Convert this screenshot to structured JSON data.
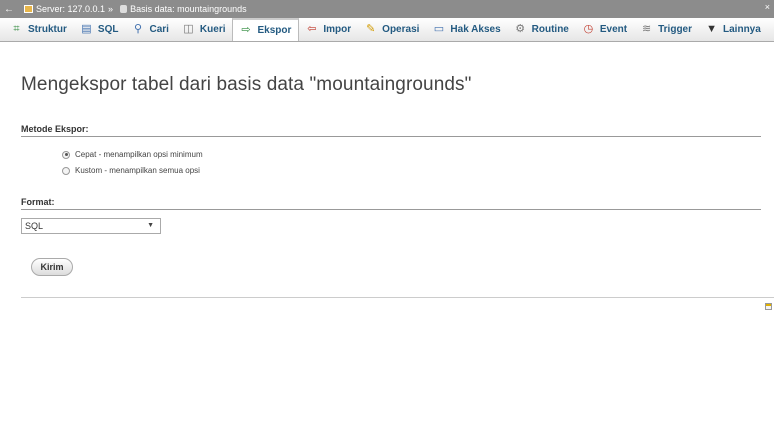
{
  "breadcrumb": {
    "back_arrow": "←",
    "server_label": "Server: 127.0.0.1",
    "separator": "»",
    "database_label": "Basis data: mountaingrounds",
    "close_glyph": "×"
  },
  "tabs": [
    {
      "label": "Struktur",
      "icon": "structure-icon",
      "glyph": "⌗",
      "color": "#2f8a3c"
    },
    {
      "label": "SQL",
      "icon": "sql-icon",
      "glyph": "▤",
      "color": "#3f6fae"
    },
    {
      "label": "Cari",
      "icon": "search-icon",
      "glyph": "⚲",
      "color": "#3f6fae"
    },
    {
      "label": "Kueri",
      "icon": "query-icon",
      "glyph": "◫",
      "color": "#777777"
    },
    {
      "label": "Ekspor",
      "icon": "export-icon",
      "glyph": "⇨",
      "color": "#2f8a3c",
      "active": true
    },
    {
      "label": "Impor",
      "icon": "import-icon",
      "glyph": "⇦",
      "color": "#c0392b"
    },
    {
      "label": "Operasi",
      "icon": "operations-icon",
      "glyph": "✎",
      "color": "#d29b00"
    },
    {
      "label": "Hak Akses",
      "icon": "privileges-icon",
      "glyph": "▭",
      "color": "#3f6fae"
    },
    {
      "label": "Routine",
      "icon": "routine-icon",
      "glyph": "⚙",
      "color": "#777777"
    },
    {
      "label": "Event",
      "icon": "event-icon",
      "glyph": "◷",
      "color": "#c0392b"
    },
    {
      "label": "Trigger",
      "icon": "trigger-icon",
      "glyph": "≋",
      "color": "#777777"
    },
    {
      "label": "Lainnya",
      "icon": "more-icon",
      "glyph": "▼",
      "color": "#333333"
    }
  ],
  "page": {
    "title": "Mengekspor tabel dari basis data \"mountaingrounds\""
  },
  "export_method": {
    "heading": "Metode Ekspor:",
    "options": [
      {
        "label": "Cepat - menampilkan opsi minimum",
        "checked": true
      },
      {
        "label": "Kustom - menampilkan semua opsi",
        "checked": false
      }
    ]
  },
  "format": {
    "heading": "Format:",
    "selected": "SQL",
    "arrow": "▼"
  },
  "submit": {
    "label": "Kirim"
  }
}
